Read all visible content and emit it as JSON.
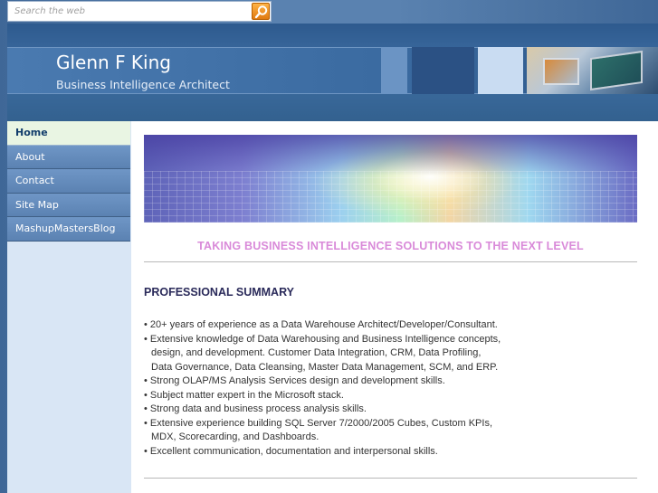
{
  "search": {
    "placeholder": "Search the web",
    "button_icon": "search-icon"
  },
  "header": {
    "title": "Glenn F King",
    "subtitle": "Business Intelligence Architect"
  },
  "sidebar": {
    "items": [
      {
        "label": "Home",
        "active": true
      },
      {
        "label": "About",
        "active": false
      },
      {
        "label": "Contact",
        "active": false
      },
      {
        "label": "Site Map",
        "active": false
      },
      {
        "label": "MashupMastersBlog",
        "active": false
      }
    ]
  },
  "main": {
    "tagline": "TAKING BUSINESS INTELLIGENCE SOLUTIONS TO THE NEXT LEVEL",
    "section_heading": "PROFESSIONAL SUMMARY",
    "summary": [
      "20+ years of experience as a Data Warehouse Architect/Developer/Consultant.",
      "Extensive knowledge of Data Warehousing and Business Intelligence concepts,\ndesign, and development. Customer Data Integration, CRM, Data Profiling,\nData Governance, Data Cleansing, Master Data Management, SCM, and ERP.",
      "Strong OLAP/MS Analysis Services design and development skills.",
      "Subject matter expert in the Microsoft stack.",
      "Strong data and business process analysis skills.",
      "Extensive experience building SQL Server 7/2000/2005 Cubes, Custom KPIs,\nMDX, Scorecarding, and Dashboards.",
      "Excellent communication, documentation and interpersonal skills."
    ]
  },
  "colors": {
    "tagline": "#d98ad9",
    "heading": "#2a2a5a",
    "nav_active_bg": "#e9f5e3",
    "nav_bg": "#5b82b2",
    "search_button": "#e07a10"
  }
}
